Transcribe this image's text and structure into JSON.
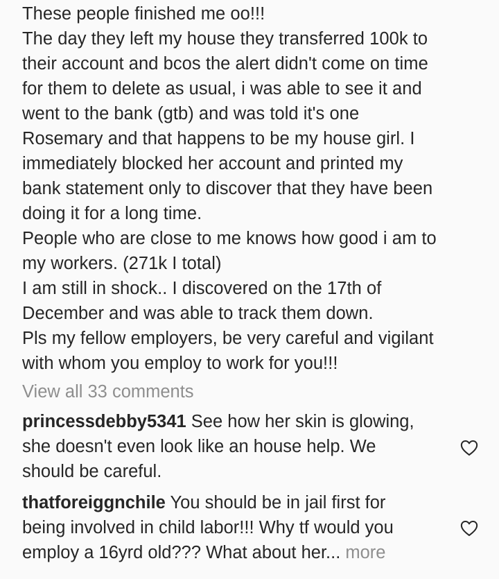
{
  "post": {
    "caption_lines": [
      "These people finished me oo!!!",
      "The day they left my house they transferred 100k to",
      "their account and bcos the alert didn't come on time",
      "for them to delete as usual, i was able to see it and",
      "went to the bank (gtb) and was told it's one",
      "Rosemary and that happens to be my house girl. I",
      "immediately blocked her account and printed my",
      "bank statement only to discover that they have been",
      "doing it for a long time.",
      "People who are close to me knows how good i am to",
      "my workers. (271k I total)",
      "I am still in shock.. I discovered on the 17th of",
      "December and was able to track them down.",
      "Pls my fellow employers, be very careful and vigilant",
      "with whom you employ to work for you!!!"
    ],
    "view_all_comments": "View all 33 comments"
  },
  "comments": [
    {
      "username": "princessdebby5341",
      "line1": " See how her skin is glowing,",
      "line2": "she doesn't even look like an house help. We",
      "line3": "should be careful.",
      "more": ""
    },
    {
      "username": "thatforeiggnchile",
      "line1": " You should be in jail first for",
      "line2": "being involved in child labor!!! Why tf would you",
      "line3": "employ a 16yrd old??? What about her...",
      "more": " more"
    }
  ],
  "icons": {
    "like": "heart-outline-icon"
  },
  "colors": {
    "text": "#262626",
    "muted": "#8e8e8e",
    "background": "#fafafa"
  }
}
